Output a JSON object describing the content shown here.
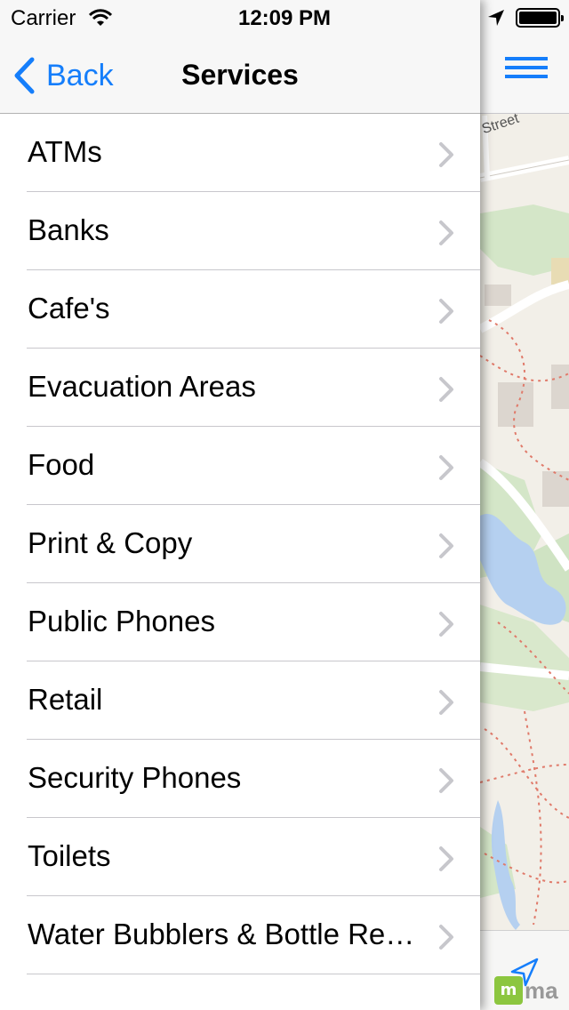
{
  "status_bar": {
    "carrier": "Carrier",
    "time": "12:09 PM"
  },
  "nav": {
    "back_label": "Back",
    "title": "Services"
  },
  "services": [
    {
      "label": "ATMs"
    },
    {
      "label": "Banks"
    },
    {
      "label": "Cafe's"
    },
    {
      "label": "Evacuation Areas"
    },
    {
      "label": "Food"
    },
    {
      "label": "Print & Copy"
    },
    {
      "label": "Public Phones"
    },
    {
      "label": "Retail"
    },
    {
      "label": "Security Phones"
    },
    {
      "label": "Toilets"
    },
    {
      "label": "Water Bubblers & Bottle Refill Stations"
    }
  ],
  "map": {
    "street_label": "Street",
    "attribution": "ma"
  },
  "colors": {
    "accent": "#157efb",
    "separator": "#c8c7cc",
    "chevron": "#c7c7cc"
  },
  "icons": [
    "wifi-icon",
    "location-arrow-icon",
    "battery-icon",
    "back-chevron-icon",
    "menu-icon",
    "chevron-right-icon",
    "navigation-arrow-icon"
  ]
}
